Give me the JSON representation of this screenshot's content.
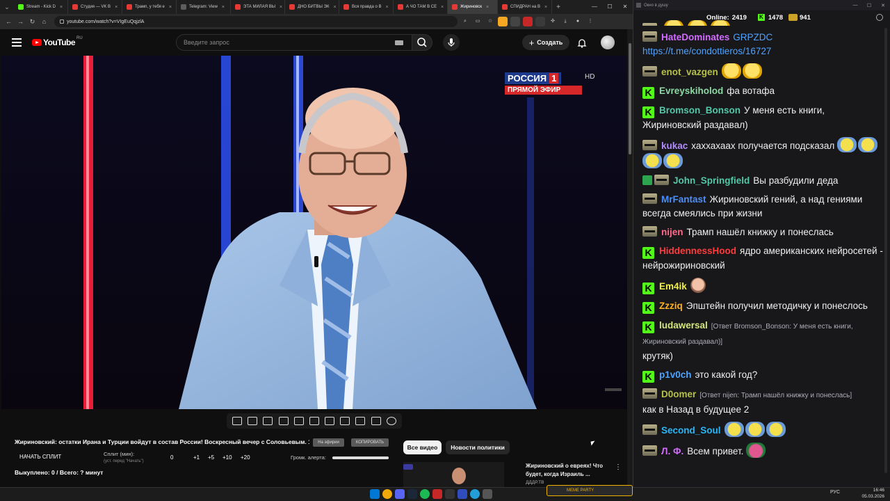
{
  "browser": {
    "tabs": [
      {
        "label": "Stream - Kick D",
        "color": "#53fc18",
        "active": false
      },
      {
        "label": "Студия — VK В",
        "color": "#e53935",
        "active": false
      },
      {
        "label": "Трамп, у тебя е",
        "color": "#e53935",
        "active": false
      },
      {
        "label": "Telegram: View",
        "color": "#5e5e5e",
        "active": false
      },
      {
        "label": "ЭТА МИЛАЯ ВЫ",
        "color": "#e53935",
        "active": false
      },
      {
        "label": "ДНО БИТВЫ ЭК",
        "color": "#e53935",
        "active": false
      },
      {
        "label": "Вся правда о В",
        "color": "#e53935",
        "active": false
      },
      {
        "label": "А ЧО ТАМ В СЕ",
        "color": "#e53935",
        "active": false
      },
      {
        "label": "Жириновск",
        "color": "#e53935",
        "active": true
      },
      {
        "label": "СПИДРАН на В",
        "color": "#e53935",
        "active": false
      }
    ],
    "url": "youtube.com/watch?v=VIgEuQqjzlA"
  },
  "youtube": {
    "logo_text": "YouTube",
    "region": "RU",
    "search_placeholder": "Введите запрос",
    "create_label": "Создать"
  },
  "video": {
    "channel_logo": "РОССИЯ",
    "channel_number": "1",
    "channel_hd": "HD",
    "live_label": "ПРЯМОЙ ЭФИР"
  },
  "below_video": {
    "title": "Жириновский: остатки Ирана и Турции войдут в состав России! Воскресный вечер с Соловьевым. 1...",
    "btn_sub": "На эфирии",
    "btn_copy": "КОПИРОВАТЬ",
    "split_start": "НАЧАТЬ СПЛИТ",
    "split_label": "Сплит (мин):",
    "split_hint": "(уст. перед \"Начать\")",
    "split_values": [
      "0",
      "+1",
      "+5",
      "+10",
      "+20"
    ],
    "alert_label": "Громк. алерта:",
    "alert_volume": 1.0,
    "drops": "Выкуплено: 0 / Всего: ? минут"
  },
  "chips": {
    "all": "Все видео",
    "news": "Новости политики"
  },
  "recommendation": {
    "title": "Жириновский о евреях! Что будет, когда Израиль ...",
    "channel": "ДДДР.ТВ"
  },
  "chat": {
    "window_title": "Окно в душу",
    "online_label": "Online:",
    "online_count": "2419",
    "count_a": "1478",
    "count_b": "941",
    "messages": [
      {
        "user": "HateDominates",
        "color": "#d36bff",
        "badges": [
          "glass"
        ],
        "text": "",
        "link": "GRPZDC https://t.me/condottieros/16727",
        "emotes": []
      },
      {
        "user": "enot_vazgen",
        "color": "#b6c04a",
        "badges": [
          "glass"
        ],
        "text": "",
        "emotes": [
          "laugh",
          "laugh"
        ]
      },
      {
        "user": "Evreyskiholod",
        "color": "#8cd9a4",
        "badges": [
          "k"
        ],
        "text": "фа вотафа",
        "emotes": []
      },
      {
        "user": "Bromson_Bonson",
        "color": "#53c7a6",
        "badges": [
          "k"
        ],
        "text": "У меня есть книги, Жириновский раздавал)",
        "emotes": []
      },
      {
        "user": "kukac",
        "color": "#b28cff",
        "badges": [
          "glass"
        ],
        "text": "хаххахаах получается подсказал",
        "emotes": [
          "troll",
          "troll",
          "troll",
          "troll"
        ]
      },
      {
        "user": "John_Springfield",
        "color": "#53c7a6",
        "badges": [
          "check",
          "glass"
        ],
        "text": "Вы разбудили деда",
        "emotes": []
      },
      {
        "user": "MrFantast",
        "color": "#4e8ef7",
        "badges": [
          "glass"
        ],
        "text": "Жириновский гений, а над гениями всегда смеялись при жизни",
        "emotes": []
      },
      {
        "user": "nijen",
        "color": "#ff6b8a",
        "badges": [
          "glass"
        ],
        "text": "Трамп нашёл книжку и понеслась",
        "emotes": []
      },
      {
        "user": "HiddennessHood",
        "color": "#ff3b3b",
        "badges": [
          "k"
        ],
        "text": "ядро американских нейросетей - нейрожириновский",
        "emotes": []
      },
      {
        "user": "Em4ik",
        "color": "#f0f04a",
        "badges": [
          "k"
        ],
        "text": "",
        "emotes": [
          "face"
        ]
      },
      {
        "user": "Zzziq",
        "color": "#ffb020",
        "badges": [
          "k"
        ],
        "text": "Эпштейн получил методичку и понеслось",
        "emotes": []
      },
      {
        "user": "ludawersal",
        "color": "#d6e67a",
        "badges": [
          "k"
        ],
        "reply": "[Ответ Bromson_Bonson: У меня есть книги, Жириновский раздавал)]",
        "text": "крутяк)",
        "emotes": []
      },
      {
        "user": "p1v0ch",
        "color": "#4ea3ff",
        "badges": [
          "k"
        ],
        "text": "это какой год?",
        "emotes": []
      },
      {
        "user": "D0omer",
        "color": "#b6c04a",
        "badges": [
          "glass"
        ],
        "reply": "[Ответ nijen: Трамп нашёл книжку и понеслась]",
        "text": "как в Назад в будущее 2",
        "emotes": []
      },
      {
        "user": "Second_Soul",
        "color": "#29b6f6",
        "badges": [
          "glass"
        ],
        "text": "",
        "emotes": [
          "troll",
          "troll",
          "troll"
        ]
      },
      {
        "user": "Л. Ф.",
        "color": "#d36bff",
        "badges": [
          "glass"
        ],
        "text": "Всем привет.",
        "emotes": [
          "frog"
        ]
      }
    ]
  },
  "taskbar": {
    "active_app": "MEME PARTY",
    "lang": "РУС",
    "time": "16:46",
    "date": "05.03.2026"
  }
}
